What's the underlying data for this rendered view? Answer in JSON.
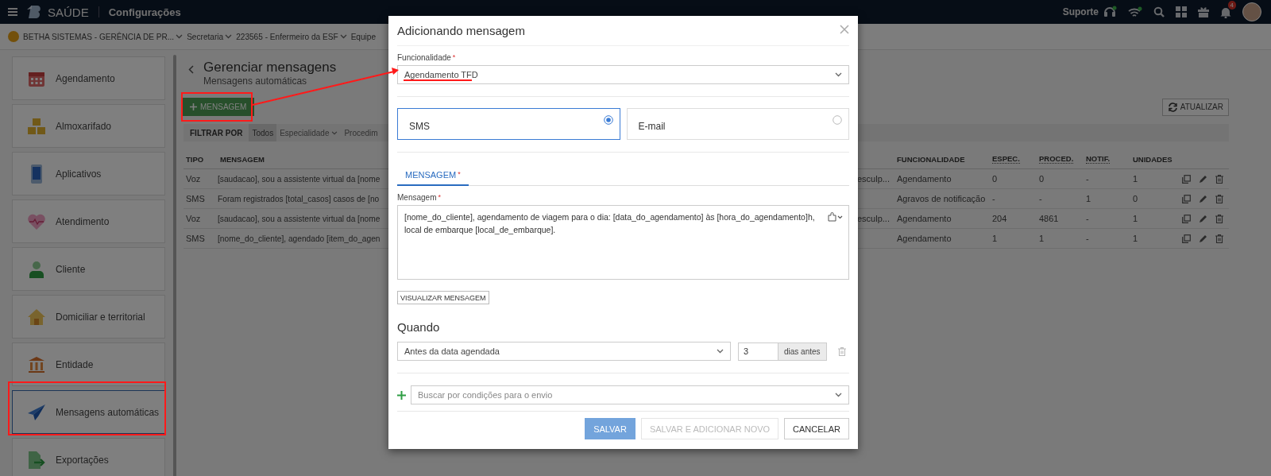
{
  "topbar": {
    "app_name": "SAÚDE",
    "section": "Configurações",
    "support_label": "Suporte",
    "notification_count": "4"
  },
  "context_bar": [
    {
      "label": "BETHA SISTEMAS - GERÊNCIA DE PR...",
      "kind": "entity",
      "dropdown": true
    },
    {
      "label": "Secretaria",
      "kind": "plain",
      "dropdown": true
    },
    {
      "label": "223565 - Enfermeiro da ESF",
      "kind": "plain",
      "dropdown": true
    },
    {
      "label": "Equipe",
      "kind": "plain",
      "dropdown": false
    }
  ],
  "sidebar": {
    "items": [
      {
        "label": "Agendamento",
        "selected": false
      },
      {
        "label": "Almoxarifado",
        "selected": false
      },
      {
        "label": "Aplicativos",
        "selected": false
      },
      {
        "label": "Atendimento",
        "selected": false
      },
      {
        "label": "Cliente",
        "selected": false
      },
      {
        "label": "Domiciliar e territorial",
        "selected": false
      },
      {
        "label": "Entidade",
        "selected": false
      },
      {
        "label": "Mensagens automáticas",
        "selected": true
      },
      {
        "label": "Exportações",
        "selected": false
      }
    ]
  },
  "page": {
    "title": "Gerenciar mensagens",
    "subtitle": "Mensagens automáticas",
    "add_button": "MENSAGEM",
    "refresh_button": "ATUALIZAR",
    "filter": {
      "label": "FILTRAR POR",
      "options": [
        {
          "label": "Todos",
          "selected": true,
          "dropdown": false
        },
        {
          "label": "Especialidade",
          "selected": false,
          "dropdown": true
        },
        {
          "label": "Procedim",
          "selected": false,
          "dropdown": false
        }
      ]
    },
    "table": {
      "columns": [
        {
          "label": "TIPO",
          "abbreviated": false
        },
        {
          "label": "MENSAGEM",
          "abbreviated": false
        },
        {
          "label": "FUNCIONALIDADE",
          "abbreviated": false
        },
        {
          "label": "ESPEC.",
          "abbreviated": true
        },
        {
          "label": "PROCED.",
          "abbreviated": true
        },
        {
          "label": "NOTIF.",
          "abbreviated": true
        },
        {
          "label": "UNIDADES",
          "abbreviated": false
        }
      ],
      "rows": [
        {
          "tipo": "Voz",
          "mensagem": "[saudacao], sou a assistente virtual da [nome",
          "column_3": "esculp...",
          "funcionalidade": "Agendamento",
          "espec": "0",
          "proced": "0",
          "notif": "-",
          "unidades": "1"
        },
        {
          "tipo": "SMS",
          "mensagem": "Foram registrados [total_casos] casos de [no",
          "funcionalidade": "Agravos de notificação",
          "espec": "-",
          "proced": "-",
          "notif": "1",
          "unidades": "0"
        },
        {
          "tipo": "Voz",
          "mensagem": "[saudacao], sou a assistente virtual da [nome",
          "column_3": "esculp...",
          "funcionalidade": "Agendamento",
          "espec": "204",
          "proced": "4861",
          "notif": "-",
          "unidades": "1"
        },
        {
          "tipo": "SMS",
          "mensagem": "[nome_do_cliente], agendado [item_do_agen",
          "funcionalidade": "Agendamento",
          "espec": "1",
          "proced": "1",
          "notif": "-",
          "unidades": "1"
        }
      ]
    }
  },
  "modal": {
    "title": "Adicionando mensagem",
    "funcionalidade": {
      "label": "Funcionalidade",
      "required_mark": "*",
      "value": "Agendamento TFD"
    },
    "channels": [
      {
        "label": "SMS",
        "selected": true
      },
      {
        "label": "E-mail",
        "selected": false
      }
    ],
    "tabs": [
      {
        "label": "MENSAGEM",
        "required_mark": "*",
        "selected": true
      }
    ],
    "message": {
      "label": "Mensagem",
      "required_mark": "*",
      "value": "[nome_do_cliente], agendamento de viagem para o dia: [data_do_agendamento] às [hora_do_agendamento]h, local de embarque [local_de_embarque]."
    },
    "preview_button": "VISUALIZAR MENSAGEM",
    "when": {
      "heading": "Quando",
      "condition": "Antes da data agendada",
      "days": "3",
      "days_unit": "dias antes"
    },
    "conditions_search": {
      "placeholder": "Buscar por condições para o envio"
    },
    "buttons": [
      {
        "label": "SALVAR",
        "kind": "primary",
        "disabled": true
      },
      {
        "label": "SALVAR E ADICIONAR NOVO",
        "kind": "secondary",
        "disabled": true
      },
      {
        "label": "CANCELAR",
        "kind": "secondary",
        "disabled": false
      }
    ]
  }
}
